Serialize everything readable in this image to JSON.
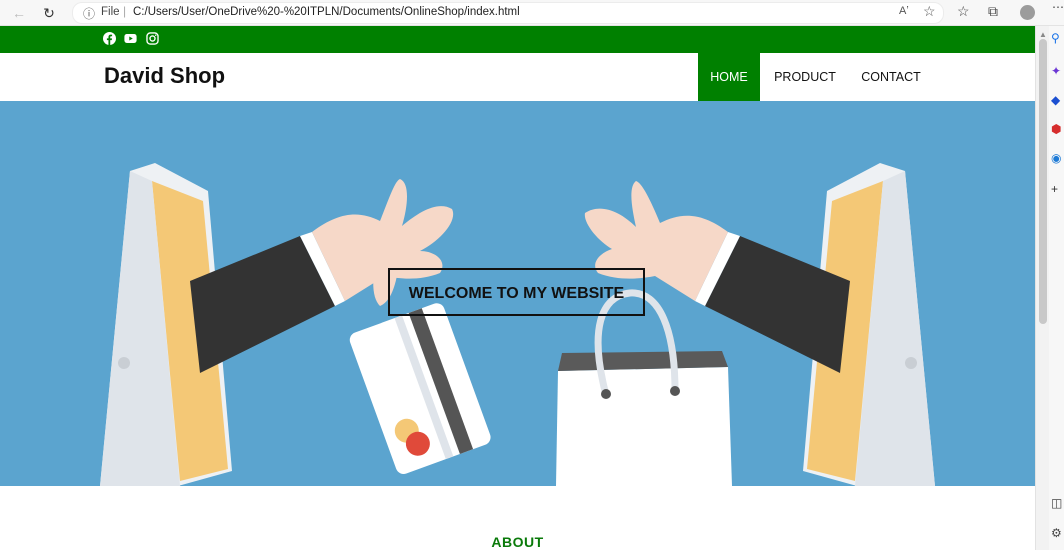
{
  "browser": {
    "back_icon": "back-arrow-icon",
    "reload_icon": "reload-icon",
    "protocol_label": "File",
    "url": "C:/Users/User/OneDrive%20-%20ITPLN/Documents/OnlineShop/index.html",
    "read_aloud": "Aʼ",
    "tools": [
      "favorites-icon",
      "collections-icon",
      "profile-icon"
    ]
  },
  "topbar": {
    "color": "#008000",
    "socials": [
      "facebook-icon",
      "youtube-icon",
      "instagram-icon"
    ]
  },
  "header": {
    "brand": "David Shop",
    "menu": [
      {
        "label": "HOME",
        "active": true
      },
      {
        "label": "PRODUCT",
        "active": false
      },
      {
        "label": "CONTACT",
        "active": false
      }
    ]
  },
  "hero": {
    "background": "#5ba4cf",
    "headline": "WELCOME TO MY WEBSITE"
  },
  "about": {
    "heading": "ABOUT"
  }
}
